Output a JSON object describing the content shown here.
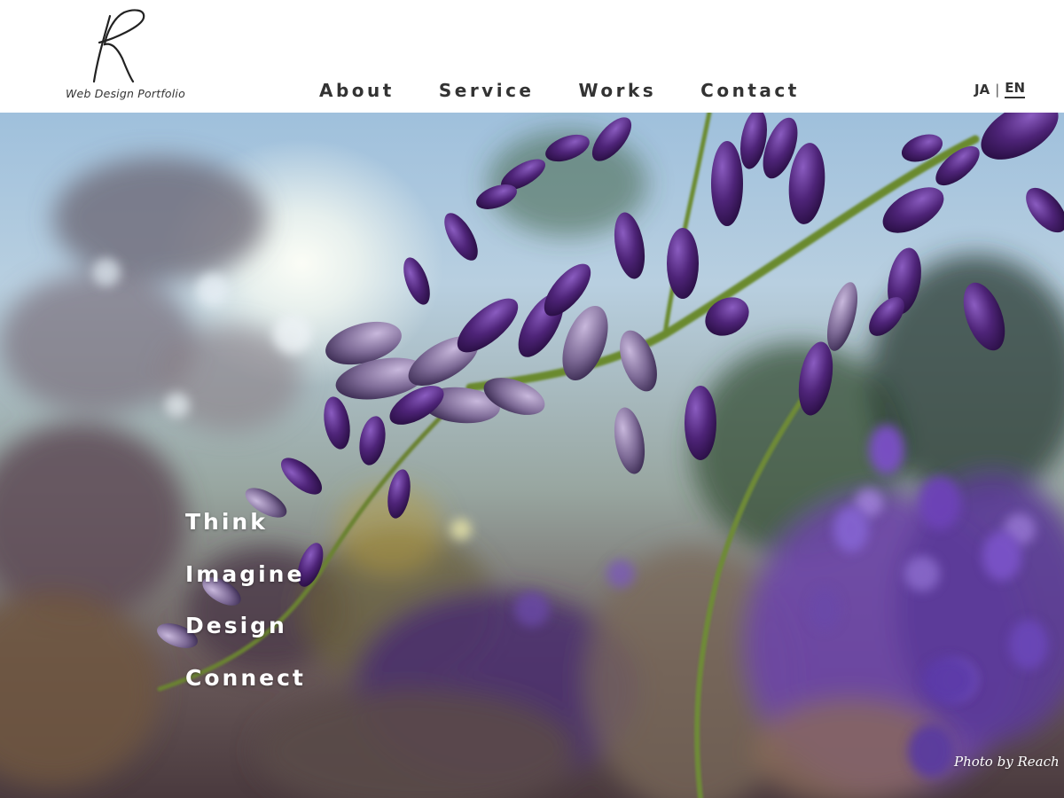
{
  "brand": {
    "monogram": "R",
    "tagline": "Web Design Portfolio"
  },
  "nav": {
    "items": [
      {
        "label": "About"
      },
      {
        "label": "Service"
      },
      {
        "label": "Works"
      },
      {
        "label": "Contact"
      }
    ]
  },
  "language": {
    "ja": "JA",
    "separator": "|",
    "en": "EN",
    "selected": "EN"
  },
  "hero": {
    "image_subject": "wisteria-flowers-photo",
    "taglines": [
      "Think",
      "Imagine",
      "Design",
      "Connect"
    ],
    "credit": "Photo by Reach"
  },
  "colors": {
    "header_bg": "#ffffff",
    "nav_text": "#333333",
    "tagline_text": "#ffffff",
    "wisteria_purple": "#5a2a86"
  }
}
